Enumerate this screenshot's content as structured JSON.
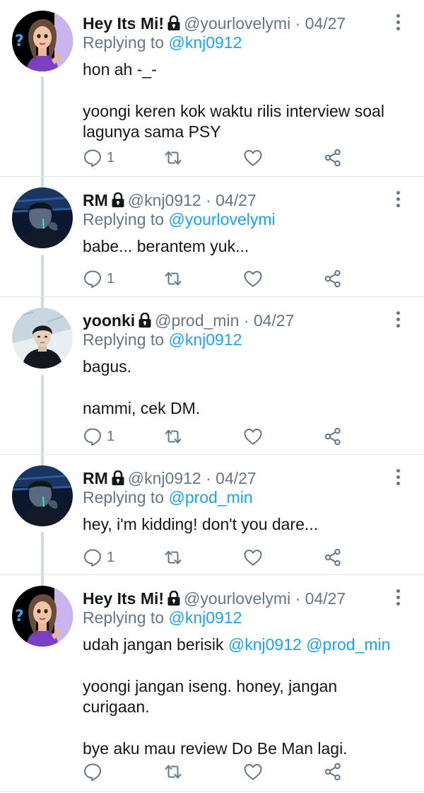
{
  "tweets": [
    {
      "name": "Hey Its Mi!",
      "handle": "@yourlovelymi",
      "date": "04/27",
      "reply_prefix": "Replying to",
      "reply_to": "@knj0912",
      "paragraphs": [
        "hon ah -_-",
        "yoongi keren kok waktu rilis interview soal lagunya sama PSY"
      ],
      "reply_count": "1",
      "avatar": "bitmoji-girl"
    },
    {
      "name": "RM",
      "handle": "@knj0912",
      "date": "04/27",
      "reply_prefix": "Replying to",
      "reply_to": "@yourlovelymi",
      "paragraphs": [
        "babe... berantem yuk..."
      ],
      "reply_count": "1",
      "avatar": "dark-photo-man"
    },
    {
      "name": "yoonki",
      "handle": "@prod_min",
      "date": "04/27",
      "reply_prefix": "Replying to",
      "reply_to": "@knj0912",
      "paragraphs": [
        "bagus.",
        "nammi, cek DM."
      ],
      "reply_count": "1",
      "avatar": "photo-man"
    },
    {
      "name": "RM",
      "handle": "@knj0912",
      "date": "04/27",
      "reply_prefix": "Replying to",
      "reply_to": "@prod_min",
      "paragraphs": [
        "hey, i'm kidding! don't you dare..."
      ],
      "reply_count": "1",
      "avatar": "dark-photo-man"
    },
    {
      "name": "Hey Its Mi!",
      "handle": "@yourlovelymi",
      "date": "04/27",
      "reply_prefix": "Replying to",
      "reply_to": "@knj0912",
      "paragraphs": [
        "udah jangan berisik",
        "yoongi jangan iseng. honey, jangan curigaan.",
        "bye aku mau review Do Be Man lagi."
      ],
      "mentions_last_line": [
        "@knj0912",
        "@prod_min"
      ],
      "reply_count": "",
      "avatar": "bitmoji-girl"
    }
  ],
  "icons": {
    "reply": "reply-icon",
    "retweet": "retweet-icon",
    "like": "heart-icon",
    "share": "share-icon",
    "lock": "lock-icon",
    "more": "more-vertical-icon"
  },
  "colors": {
    "text": "#14171a",
    "muted": "#657786",
    "mention": "#1da1f2",
    "separator": "#e1e8ed"
  },
  "separator_dot": "·"
}
